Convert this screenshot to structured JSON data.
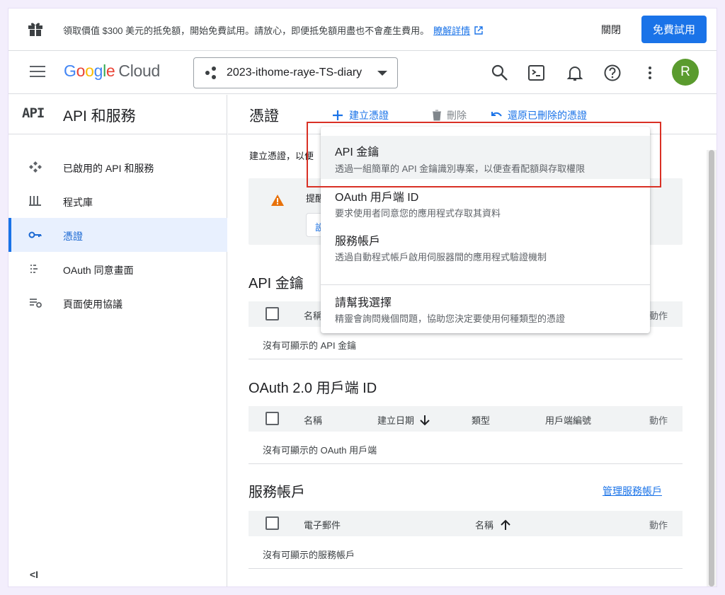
{
  "banner": {
    "message": "領取價值 $300 美元的抵免額，開始免費試用。請放心，即便抵免額用盡也不會產生費用。",
    "learn_more": "瞭解詳情",
    "close": "關閉",
    "free_trial": "免費試用"
  },
  "header": {
    "logo_google": [
      "G",
      "o",
      "o",
      "g",
      "l",
      "e"
    ],
    "logo_cloud": "Cloud",
    "project_name": "2023-ithome-raye-TS-diary",
    "avatar_letter": "R",
    "icons": [
      "search-icon",
      "cloud-shell-icon",
      "notifications-icon",
      "help-icon",
      "more-vert-icon"
    ]
  },
  "sidebar": {
    "api_mark": "API",
    "title": "API 和服務",
    "items": [
      {
        "label": "已啟用的 API 和服務",
        "icon": "enabled-apis-icon",
        "active": false
      },
      {
        "label": "程式庫",
        "icon": "library-icon",
        "active": false
      },
      {
        "label": "憑證",
        "icon": "key-icon",
        "active": true
      },
      {
        "label": "OAuth 同意畫面",
        "icon": "consent-icon",
        "active": false
      },
      {
        "label": "頁面使用協議",
        "icon": "agreement-icon",
        "active": false
      }
    ],
    "collapse": "<I"
  },
  "toolbar": {
    "page_title": "憑證",
    "create": "建立憑證",
    "delete": "刪除",
    "restore": "還原已刪除的憑證"
  },
  "main": {
    "intro": "建立憑證，以便",
    "warning_text": "提醒",
    "warning_button": "設",
    "api_keys": {
      "title": "API 金鑰",
      "col_name": "名稱",
      "col_action": "動作",
      "empty": "沒有可顯示的 API 金鑰"
    },
    "oauth": {
      "title": "OAuth 2.0 用戶端 ID",
      "col_name": "名稱",
      "col_date": "建立日期",
      "col_type": "類型",
      "col_client_id": "用戶端編號",
      "col_action": "動作",
      "empty": "沒有可顯示的 OAuth 用戶端"
    },
    "service_accounts": {
      "title": "服務帳戶",
      "manage": "管理服務帳戶",
      "col_email": "電子郵件",
      "col_name": "名稱",
      "col_action": "動作",
      "empty": "沒有可顯示的服務帳戶"
    }
  },
  "menu": {
    "items": [
      {
        "title": "API 金鑰",
        "desc": "透過一組簡單的 API 金鑰識別專案，以便查看配額與存取權限",
        "highlighted": true
      },
      {
        "title": "OAuth 用戶端 ID",
        "desc": "要求使用者同意您的應用程式存取其資料",
        "highlighted": false
      },
      {
        "title": "服務帳戶",
        "desc": "透過自動程式帳戶啟用伺服器間的應用程式驗證機制",
        "highlighted": false
      },
      {
        "title": "請幫我選擇",
        "desc": "精靈會詢問幾個問題，協助您決定要使用何種類型的憑證",
        "highlighted": false
      }
    ]
  },
  "colors": {
    "accent": "#1a73e8",
    "highlight_box": "#d93025",
    "warning": "#e8710a",
    "avatar": "#5a9b2e"
  }
}
